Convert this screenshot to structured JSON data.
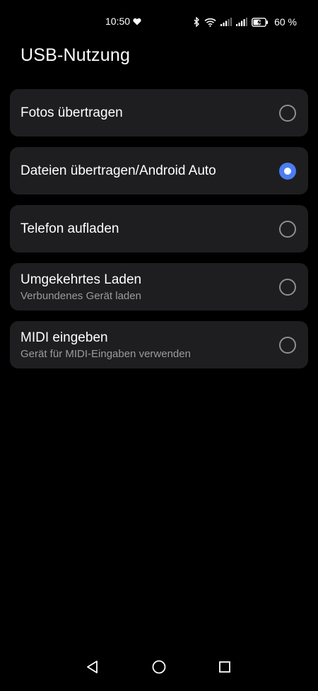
{
  "status_bar": {
    "time": "10:50",
    "battery_percent": "60 %",
    "icons": [
      "heart-icon",
      "bluetooth-icon",
      "wifi-icon",
      "signal-icon",
      "signal-icon",
      "battery-charging-icon"
    ]
  },
  "page": {
    "title": "USB-Nutzung"
  },
  "options": [
    {
      "title": "Fotos übertragen",
      "subtitle": "",
      "selected": false
    },
    {
      "title": "Dateien übertragen/Android Auto",
      "subtitle": "",
      "selected": true
    },
    {
      "title": "Telefon aufladen",
      "subtitle": "",
      "selected": false
    },
    {
      "title": "Umgekehrtes Laden",
      "subtitle": "Verbundenes Gerät laden",
      "selected": false
    },
    {
      "title": "MIDI eingeben",
      "subtitle": "Gerät für MIDI-Eingaben verwenden",
      "selected": false
    }
  ],
  "nav_bar": {
    "icons": [
      "back-icon",
      "home-icon",
      "recents-icon"
    ]
  },
  "colors": {
    "background": "#000000",
    "card": "#1e1e21",
    "accent": "#4a7df0",
    "subtitle": "#9a9a9f"
  }
}
